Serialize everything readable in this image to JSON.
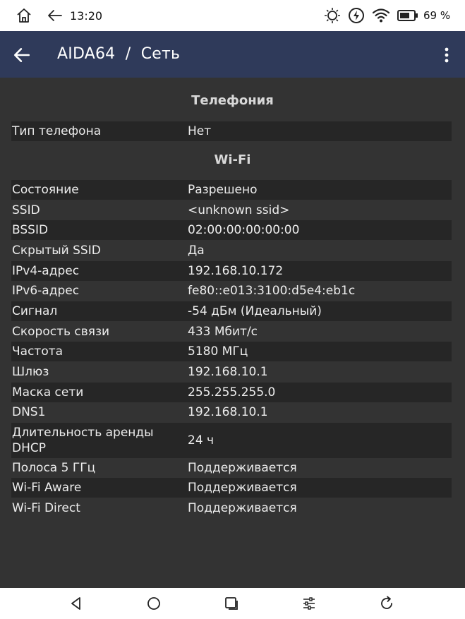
{
  "status_bar": {
    "time": "13:20",
    "battery_percent": "69 %",
    "icons": [
      "home-icon",
      "back-arrow-icon",
      "brightness-icon",
      "sync-icon",
      "wifi-icon",
      "battery-icon"
    ]
  },
  "app_bar": {
    "title": "AIDA64  /  Сеть",
    "icons": [
      "back-arrow-icon",
      "more-vert-icon"
    ]
  },
  "sections": [
    {
      "title": "Телефония",
      "rows": [
        {
          "label": "Тип телефона",
          "value": "Нет"
        }
      ]
    },
    {
      "title": "Wi-Fi",
      "rows": [
        {
          "label": "Состояние",
          "value": "Разрешено"
        },
        {
          "label": "SSID",
          "value": "<unknown ssid>"
        },
        {
          "label": "BSSID",
          "value": "02:00:00:00:00:00"
        },
        {
          "label": "Скрытый SSID",
          "value": "Да"
        },
        {
          "label": "IPv4-адрес",
          "value": "192.168.10.172"
        },
        {
          "label": "IPv6-адрес",
          "value": "fe80::e013:3100:d5e4:eb1c"
        },
        {
          "label": "Сигнал",
          "value": "-54 дБм (Идеальный)"
        },
        {
          "label": "Скорость связи",
          "value": "433 Мбит/с"
        },
        {
          "label": "Частота",
          "value": "5180 МГц"
        },
        {
          "label": "Шлюз",
          "value": "192.168.10.1"
        },
        {
          "label": "Маска сети",
          "value": "255.255.255.0"
        },
        {
          "label": "DNS1",
          "value": "192.168.10.1"
        },
        {
          "label": "Длительность аренды DHCP",
          "value": "24 ч"
        },
        {
          "label": "Полоса 5 ГГц",
          "value": "Поддерживается"
        },
        {
          "label": "Wi-Fi Aware",
          "value": "Поддерживается"
        },
        {
          "label": "Wi-Fi Direct",
          "value": "Поддерживается"
        }
      ]
    }
  ],
  "nav_bar": {
    "icons": [
      "nav-back-icon",
      "nav-home-icon",
      "nav-recents-icon",
      "nav-settings-icon",
      "nav-refresh-icon"
    ]
  },
  "colors": {
    "app_bar": "#2f3a5a",
    "background": "#333333",
    "row_stripe": "#262626",
    "text": "#ececec"
  }
}
